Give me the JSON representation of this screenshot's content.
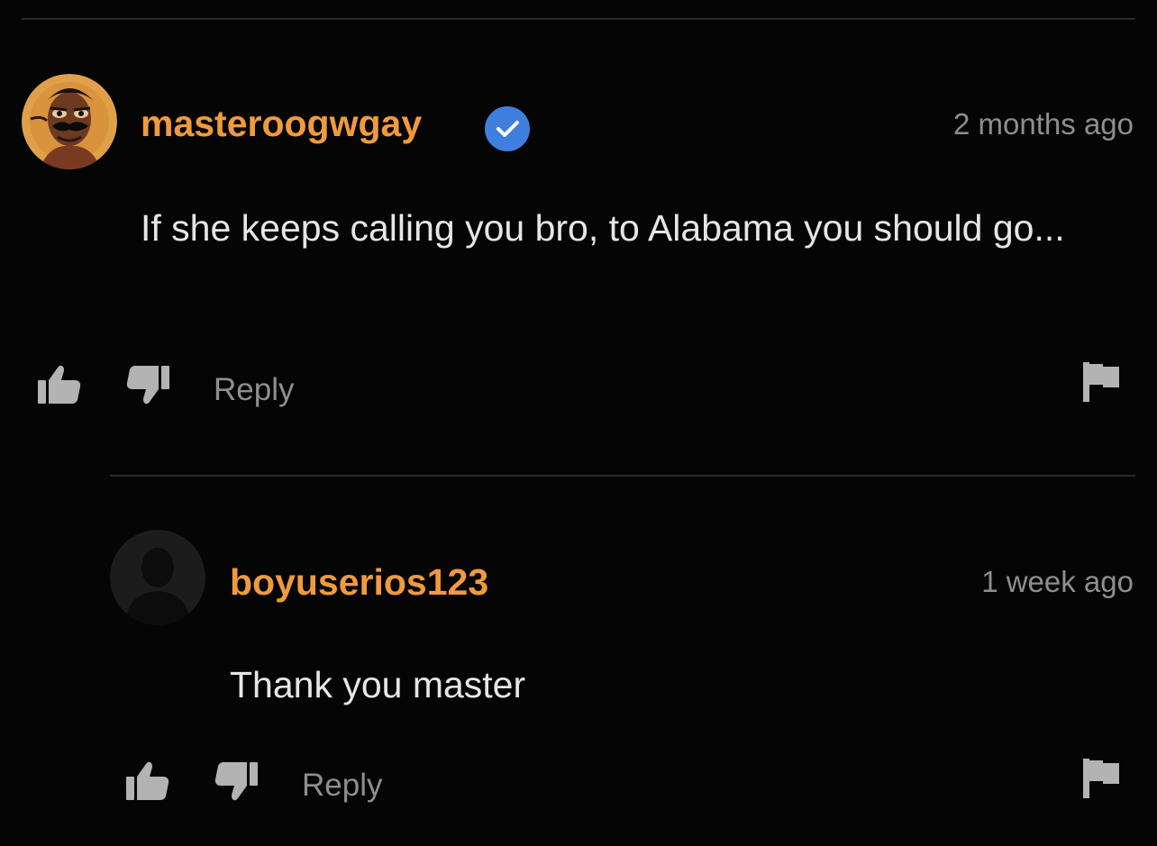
{
  "colors": {
    "background": "#050505",
    "username": "#f09a3e",
    "verified_badge": "#3f7fe0",
    "muted_text": "#8e8e8e",
    "icon": "#b3b3b3",
    "divider": "#2a2a2a"
  },
  "comments": [
    {
      "username": "masteroogwgay",
      "verified": true,
      "verified_icon": "check-badge-icon",
      "avatar_icon": "cartoon-avatar",
      "timestamp": "2 months ago",
      "text": "If she keeps calling you bro, to Alabama you should go...",
      "actions": {
        "like_icon": "thumbs-up-icon",
        "dislike_icon": "thumbs-down-icon",
        "reply_label": "Reply",
        "flag_icon": "flag-icon"
      }
    },
    {
      "username": "boyuserios123",
      "verified": false,
      "avatar_icon": "default-user-avatar",
      "timestamp": "1 week ago",
      "text": "Thank you master",
      "actions": {
        "like_icon": "thumbs-up-icon",
        "dislike_icon": "thumbs-down-icon",
        "reply_label": "Reply",
        "flag_icon": "flag-icon"
      }
    }
  ]
}
